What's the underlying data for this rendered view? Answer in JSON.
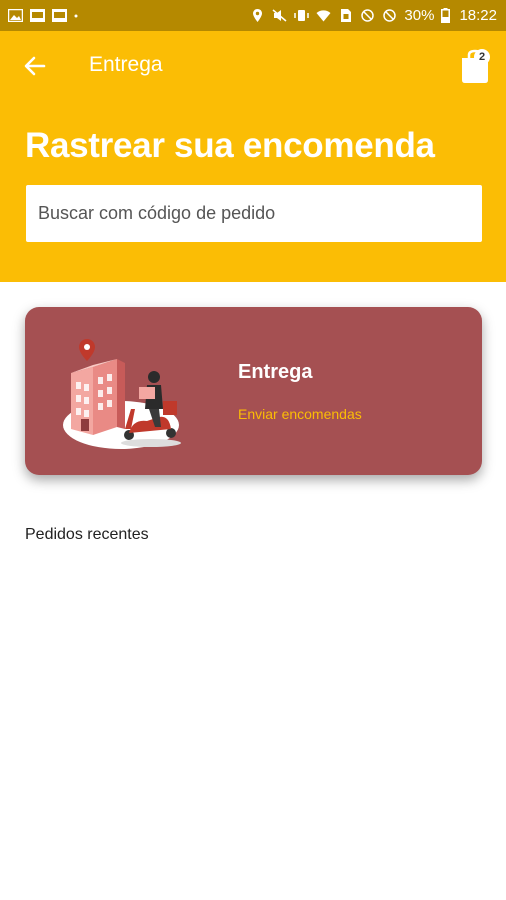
{
  "status_bar": {
    "battery": "30%",
    "time": "18:22"
  },
  "toolbar": {
    "title": "Entrega",
    "cart_count": "2"
  },
  "header": {
    "title": "Rastrear sua encomenda"
  },
  "search": {
    "placeholder": "Buscar com código de pedido"
  },
  "delivery_card": {
    "title": "Entrega",
    "subtitle": "Enviar encomendas"
  },
  "recent": {
    "label": "Pedidos recentes"
  },
  "colors": {
    "primary": "#FBBD05",
    "status_bar": "#B58900",
    "card": "#A55052",
    "accent_text": "#FBBD05"
  }
}
